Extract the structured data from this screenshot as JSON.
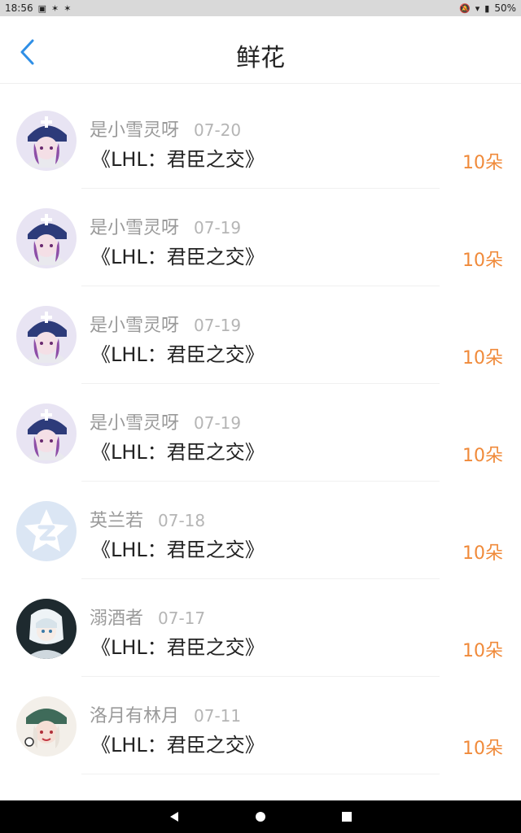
{
  "status_bar": {
    "time": "18:56",
    "notif_icons": [
      "image-icon",
      "notif-glyph-icon",
      "notif-glyph-icon"
    ],
    "battery": "50%"
  },
  "header": {
    "title": "鲜花"
  },
  "items": [
    {
      "username": "是小雪灵呀",
      "date": "07-20",
      "book": "《LHL：君臣之交》",
      "amount": "10朵",
      "avatar": "anime-avatar-a"
    },
    {
      "username": "是小雪灵呀",
      "date": "07-19",
      "book": "《LHL：君臣之交》",
      "amount": "10朵",
      "avatar": "anime-avatar-a"
    },
    {
      "username": "是小雪灵呀",
      "date": "07-19",
      "book": "《LHL：君臣之交》",
      "amount": "10朵",
      "avatar": "anime-avatar-a"
    },
    {
      "username": "是小雪灵呀",
      "date": "07-19",
      "book": "《LHL：君臣之交》",
      "amount": "10朵",
      "avatar": "anime-avatar-a"
    },
    {
      "username": "英兰若",
      "date": "07-18",
      "book": "《LHL：君臣之交》",
      "amount": "10朵",
      "avatar": "default-star-avatar"
    },
    {
      "username": "溺酒者",
      "date": "07-17",
      "book": "《LHL：君臣之交》",
      "amount": "10朵",
      "avatar": "anime-avatar-b"
    },
    {
      "username": "洛月有林月",
      "date": "07-11",
      "book": "《LHL：君臣之交》",
      "amount": "10朵",
      "avatar": "anime-avatar-c"
    }
  ],
  "colors": {
    "accent": "#2f8fe6",
    "amount": "#f08a3a",
    "muted": "#9a9a9a"
  }
}
